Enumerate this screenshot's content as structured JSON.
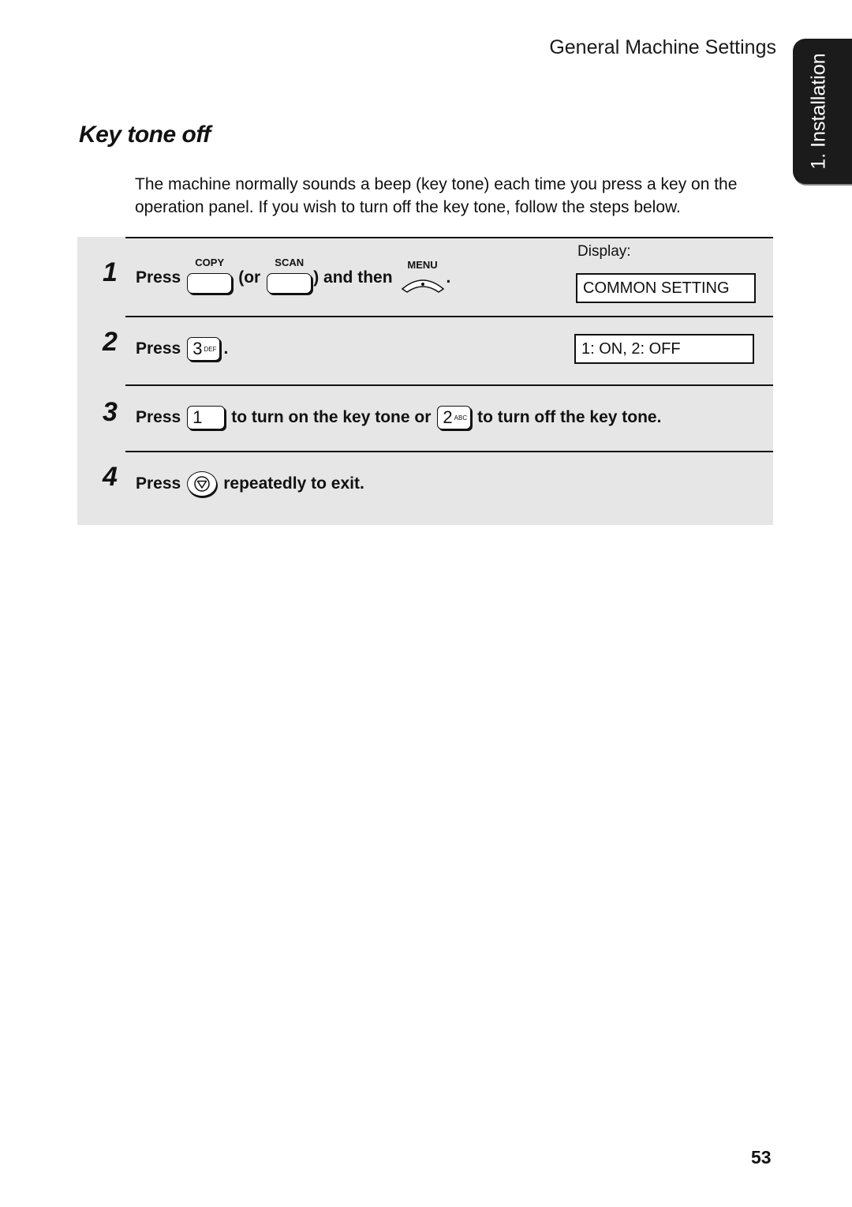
{
  "header": {
    "section_title": "General Machine Settings",
    "chapter_tab": "1. Installation"
  },
  "title": "Key tone off",
  "intro": "The machine normally sounds a beep (key tone) each time you press a key on the operation panel. If you wish to turn off the key tone, follow the steps below.",
  "display_label": "Display:",
  "steps": [
    {
      "number": "1",
      "press": "Press",
      "or_text": "(or",
      "and_then": ") and then",
      "period": ".",
      "keys": {
        "copy": "COPY",
        "scan": "SCAN",
        "menu": "MENU"
      },
      "display": "COMMON SETTING"
    },
    {
      "number": "2",
      "press": "Press",
      "period": ".",
      "key": {
        "digit": "3",
        "letters": "DEF"
      },
      "display": "1: ON, 2: OFF"
    },
    {
      "number": "3",
      "press": "Press",
      "key_on": {
        "digit": "1",
        "letters": ""
      },
      "text_on": "to turn on the key tone or",
      "key_off": {
        "digit": "2",
        "letters": "ABC"
      },
      "text_off": "to turn off the key tone."
    },
    {
      "number": "4",
      "press": "Press",
      "key_icon": "stop-icon",
      "text": "repeatedly to exit."
    }
  ],
  "page_number": "53"
}
